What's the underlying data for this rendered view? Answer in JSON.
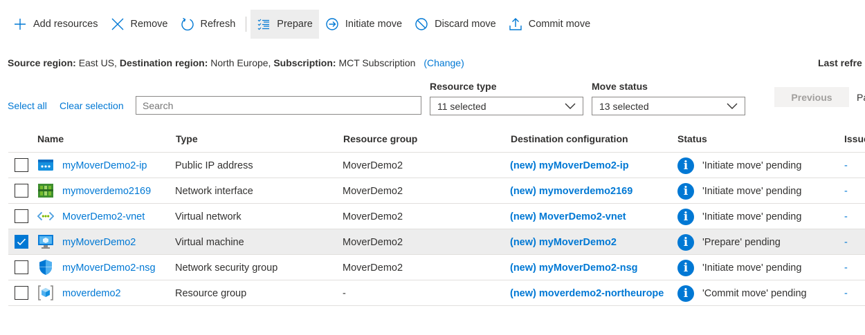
{
  "toolbar": {
    "add": "Add resources",
    "remove": "Remove",
    "refresh": "Refresh",
    "prepare": "Prepare",
    "initiate": "Initiate move",
    "discard": "Discard move",
    "commit": "Commit move"
  },
  "region": {
    "source_label": "Source region:",
    "source_value": "East US,",
    "dest_label": "Destination region:",
    "dest_value": "North Europe,",
    "sub_label": "Subscription:",
    "sub_value": "MCT Subscription",
    "change": "(Change)",
    "last_refreshed": "Last refre"
  },
  "filters": {
    "select_all": "Select all",
    "clear_selection": "Clear selection",
    "search_placeholder": "Search",
    "resource_type_label": "Resource type",
    "resource_type_value": "11 selected",
    "move_status_label": "Move status",
    "move_status_value": "13 selected",
    "previous": "Previous",
    "page": "Pa"
  },
  "table": {
    "headers": {
      "name": "Name",
      "type": "Type",
      "group": "Resource group",
      "dest": "Destination configuration",
      "status": "Status",
      "issues": "Issue"
    },
    "rows": [
      {
        "name": "myMoverDemo2-ip",
        "type": "Public IP address",
        "group": "MoverDemo2",
        "dest": "(new) myMoverDemo2-ip",
        "status": "'Initiate move' pending",
        "issues": "-",
        "icon": "public-ip-icon",
        "selected": false
      },
      {
        "name": "mymoverdemo2169",
        "type": "Network interface",
        "group": "MoverDemo2",
        "dest": "(new) mymoverdemo2169",
        "status": "'Initiate move' pending",
        "issues": "-",
        "icon": "network-interface-icon",
        "selected": false
      },
      {
        "name": "MoverDemo2-vnet",
        "type": "Virtual network",
        "group": "MoverDemo2",
        "dest": "(new) MoverDemo2-vnet",
        "status": "'Initiate move' pending",
        "issues": "-",
        "icon": "virtual-network-icon",
        "selected": false
      },
      {
        "name": "myMoverDemo2",
        "type": "Virtual machine",
        "group": "MoverDemo2",
        "dest": "(new) myMoverDemo2",
        "status": "'Prepare' pending",
        "issues": "-",
        "icon": "virtual-machine-icon",
        "selected": true
      },
      {
        "name": "myMoverDemo2-nsg",
        "type": "Network security group",
        "group": "MoverDemo2",
        "dest": "(new) myMoverDemo2-nsg",
        "status": "'Initiate move' pending",
        "issues": "-",
        "icon": "shield-icon",
        "selected": false
      },
      {
        "name": "moverdemo2",
        "type": "Resource group",
        "group": "-",
        "dest": "(new) moverdemo2-northeurope",
        "status": "'Commit move' pending",
        "issues": "-",
        "icon": "resource-group-icon",
        "selected": false
      }
    ]
  },
  "colors": {
    "accent": "#0078d4",
    "text": "#323130",
    "selected_row": "#ededed"
  }
}
